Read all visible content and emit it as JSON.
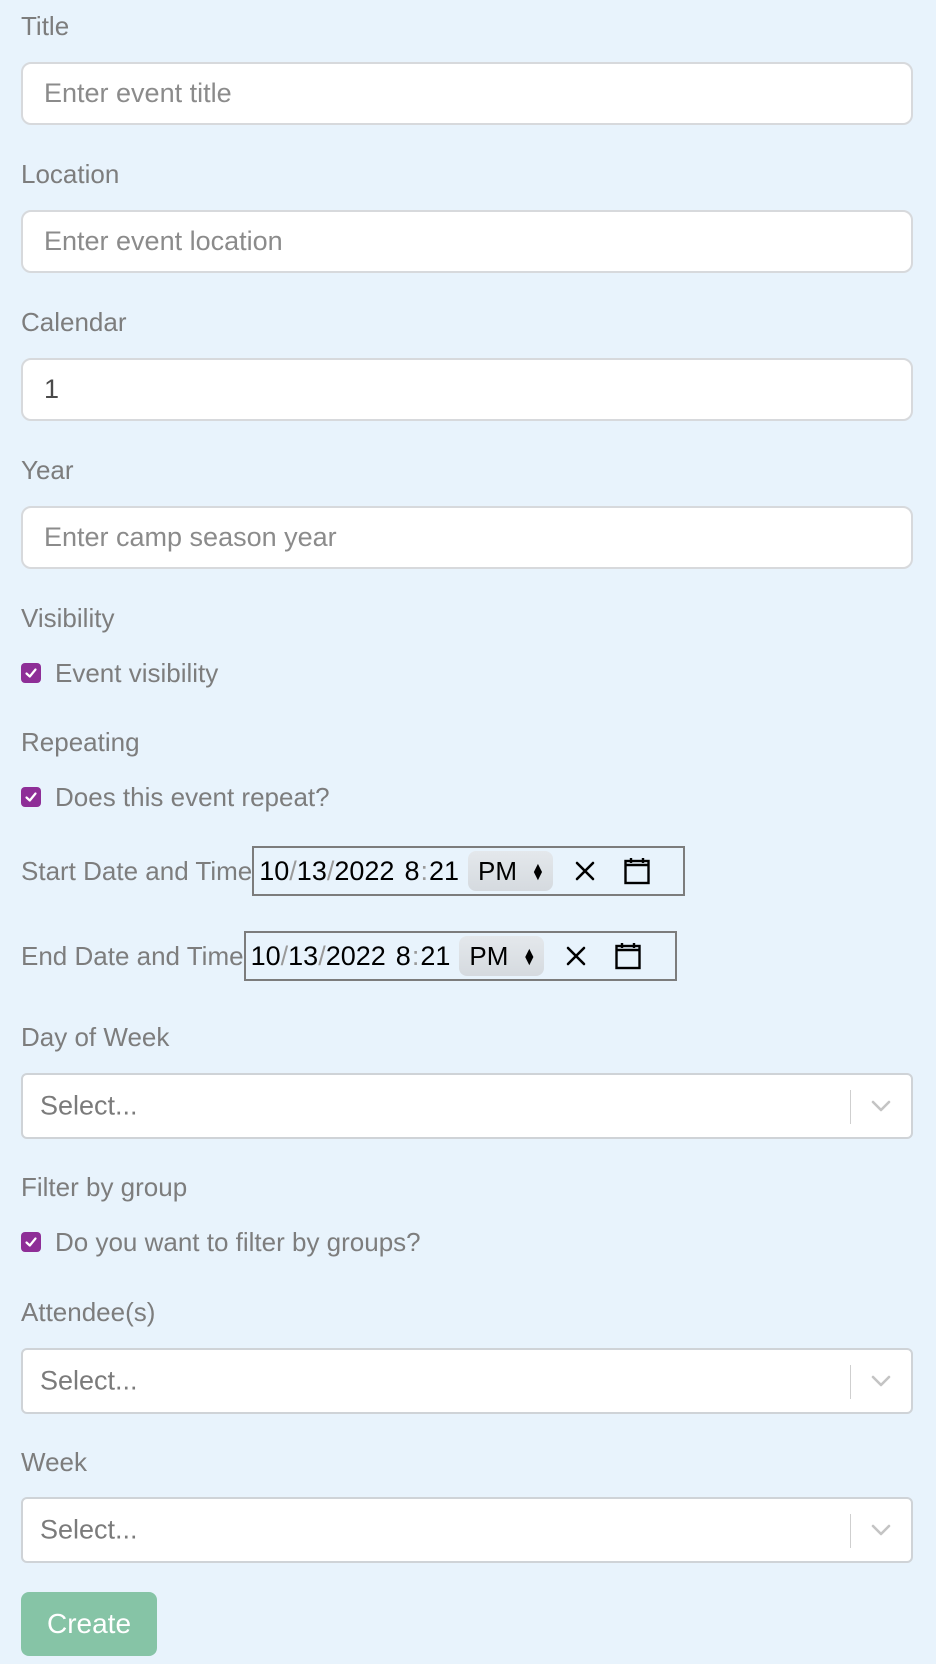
{
  "form": {
    "title": {
      "label": "Title",
      "placeholder": "Enter event title",
      "value": ""
    },
    "location": {
      "label": "Location",
      "placeholder": "Enter event location",
      "value": ""
    },
    "calendar": {
      "label": "Calendar",
      "value": "1"
    },
    "year": {
      "label": "Year",
      "placeholder": "Enter camp season year",
      "value": ""
    },
    "visibility": {
      "label": "Visibility",
      "checkbox_label": "Event visibility",
      "checked": true
    },
    "repeating": {
      "label": "Repeating",
      "checkbox_label": "Does this event repeat?",
      "checked": true
    },
    "start_datetime": {
      "label": "Start Date and Time",
      "month": "10",
      "day": "13",
      "year": "2022",
      "hour": "8",
      "minute": "21",
      "ampm": "PM"
    },
    "end_datetime": {
      "label": "End Date and Time",
      "month": "10",
      "day": "13",
      "year": "2022",
      "hour": "8",
      "minute": "21",
      "ampm": "PM"
    },
    "day_of_week": {
      "label": "Day of Week",
      "placeholder": "Select..."
    },
    "filter_by_group": {
      "label": "Filter by group",
      "checkbox_label": "Do you want to filter by groups?",
      "checked": true
    },
    "attendees": {
      "label": "Attendee(s)",
      "placeholder": "Select..."
    },
    "week": {
      "label": "Week",
      "placeholder": "Select..."
    },
    "submit_label": "Create"
  },
  "colors": {
    "page_background": "#e8f3fc",
    "checkbox_accent": "#8e2e97",
    "create_button": "#86c4a6"
  },
  "icons": {
    "checkbox": "checkmark-icon",
    "clear": "close-icon",
    "calendar": "calendar-icon",
    "select": "chevron-down-icon"
  }
}
